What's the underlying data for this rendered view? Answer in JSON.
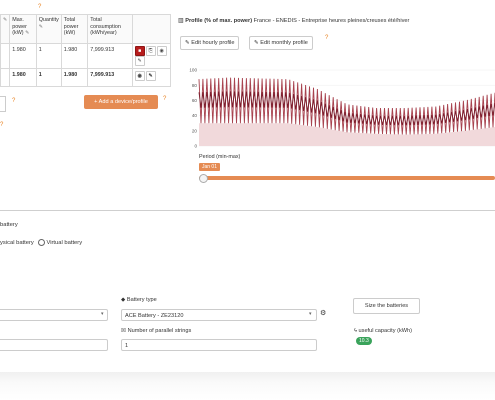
{
  "table": {
    "headers": [
      "Max. power (kW)",
      "Quantity",
      "Total power (kW)",
      "Total consumption (kWh/year)"
    ],
    "rows": [
      {
        "max_power": "1.980",
        "quantity": "1",
        "total_power": "1.980",
        "consumption": "7,999.913"
      }
    ],
    "total": {
      "max_power": "1.980",
      "quantity": "1",
      "total_power": "1.980",
      "consumption": "7,999.913"
    }
  },
  "add_device_label": "+ Add a device/profile",
  "chart_header": {
    "title": "Profile (% of max. power)",
    "subtitle": "France - ENEDIS - Entreprise heures pleines/creuses été/hiver",
    "edit_hourly": "Edit hourly profile",
    "edit_monthly": "Edit monthly profile"
  },
  "chart_data": {
    "type": "area",
    "ylim": [
      0,
      100
    ],
    "y_ticks": [
      "100",
      "80",
      "60",
      "40",
      "20",
      "0"
    ],
    "x": [
      0,
      0.1,
      0.2,
      0.3,
      0.4,
      0.5,
      0.6,
      0.7,
      0.8,
      0.9,
      1.0
    ],
    "series": [
      {
        "values": [
          88,
          90,
          89,
          88,
          75,
          55,
          50,
          50,
          52,
          60,
          70
        ]
      },
      {
        "values": [
          30,
          30,
          30,
          30,
          25,
          18,
          16,
          15,
          16,
          20,
          25
        ]
      }
    ],
    "colors": {
      "band": "#a8434f",
      "dark": "#7a1d2c",
      "fill": "#f1d9db"
    }
  },
  "period": {
    "label": "Period (min-max)",
    "date": "Jan 01"
  },
  "battery": {
    "section_title": "battery",
    "radio_physical": "ysical battery",
    "radio_virtual": "Virtual battery",
    "type_label": "Battery type",
    "type_value": "ACE Battery - ZE23120",
    "strings_label": "Number of parallel strings",
    "strings_value": "1",
    "size_button": "Size the batteries",
    "capacity_label": "useful capacity (kWh)",
    "capacity_value": "10.3"
  },
  "icons": {
    "help": "?",
    "gear": "⚙"
  }
}
